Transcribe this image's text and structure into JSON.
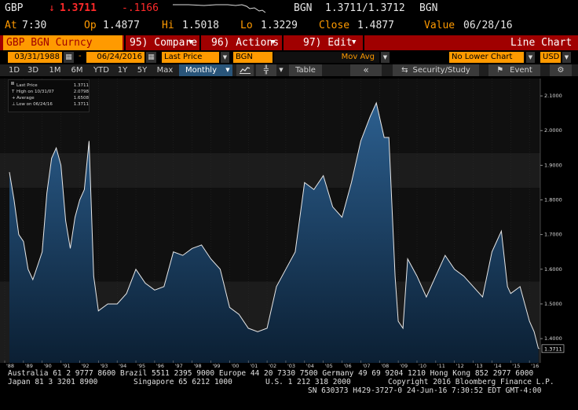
{
  "header": {
    "ticker": "GBP",
    "arrow": "↓",
    "last": "1.3711",
    "change": "-.1166",
    "source": "BGN",
    "bid_ask": "1.3711/1.3712",
    "source2": "BGN",
    "at_label": "At",
    "at_time": "7:30",
    "op_label": "Op",
    "op_value": "1.4877",
    "hi_label": "Hi",
    "hi_value": "1.5018",
    "lo_label": "Lo",
    "lo_value": "1.3229",
    "close_label": "Close",
    "close_value": "1.4877",
    "value_label": "Value",
    "value_date": "06/28/16"
  },
  "menubar": {
    "title": "GBP BGN Curncy",
    "compare": "95) Compare",
    "actions": "96) Actions",
    "edit": "97) Edit",
    "chart_type": "Line Chart"
  },
  "inputs": {
    "start_date": "03/31/1988",
    "dash": "-",
    "end_date": "06/24/2016",
    "field": "Last Price",
    "source": "BGN",
    "study": "Mov Avg",
    "lower_chart": "No Lower Chart",
    "currency": "USD"
  },
  "toolbar": {
    "periods": [
      "1D",
      "3D",
      "1M",
      "6M",
      "YTD",
      "1Y",
      "5Y",
      "Max"
    ],
    "frequency": "Monthly",
    "table": "Table",
    "security_study": "Security/Study",
    "event": "Event"
  },
  "legend": {
    "rows": [
      {
        "label": "Last Price",
        "value": "1.3711"
      },
      {
        "label": "High on 10/31/07",
        "value": "2.0798"
      },
      {
        "label": "Average",
        "value": "1.6508"
      },
      {
        "label": "Low on 06/24/16",
        "value": "1.3711"
      }
    ]
  },
  "chart_data": {
    "type": "area",
    "title": "",
    "xlabel": "",
    "ylabel": "",
    "ylim": [
      1.33,
      2.15
    ],
    "yticks": [
      "2.1000",
      "2.0000",
      "1.9000",
      "1.8000",
      "1.7000",
      "1.6000",
      "1.5000",
      "1.4000"
    ],
    "ytick_values": [
      2.1,
      2.0,
      1.9,
      1.8,
      1.7,
      1.6,
      1.5,
      1.4
    ],
    "xticks": [
      "'88",
      "'89",
      "'90",
      "'91",
      "'92",
      "'93",
      "'94",
      "'95",
      "'96",
      "'97",
      "'98",
      "'99",
      "'00",
      "'01",
      "'02",
      "'03",
      "'04",
      "'05",
      "'06",
      "'07",
      "'08",
      "'09",
      "'10",
      "'11",
      "'12",
      "'13",
      "'14",
      "'15",
      "'16"
    ],
    "last_value_label": "1.3711",
    "series": [
      {
        "x": [
          1988.25,
          1988.5,
          1988.75,
          1989.0,
          1989.25,
          1989.5,
          1989.75,
          1990.0,
          1990.25,
          1990.5,
          1990.75,
          1991.0,
          1991.25,
          1991.5,
          1991.75,
          1992.0,
          1992.25,
          1992.5,
          1992.75,
          1993.0,
          1993.5,
          1994.0,
          1994.5,
          1995.0,
          1995.5,
          1996.0,
          1996.5,
          1997.0,
          1997.5,
          1998.0,
          1998.5,
          1999.0,
          1999.5,
          2000.0,
          2000.5,
          2001.0,
          2001.5,
          2002.0,
          2002.5,
          2003.0,
          2003.5,
          2004.0,
          2004.5,
          2005.0,
          2005.5,
          2006.0,
          2006.5,
          2007.0,
          2007.5,
          2007.83,
          2008.25,
          2008.5,
          2008.83,
          2009.0,
          2009.25,
          2009.5,
          2010.0,
          2010.5,
          2011.0,
          2011.5,
          2012.0,
          2012.5,
          2013.0,
          2013.5,
          2014.0,
          2014.5,
          2014.83,
          2015.0,
          2015.5,
          2016.0,
          2016.25,
          2016.48
        ],
        "y": [
          1.88,
          1.8,
          1.7,
          1.68,
          1.6,
          1.57,
          1.61,
          1.65,
          1.82,
          1.92,
          1.95,
          1.9,
          1.74,
          1.66,
          1.75,
          1.8,
          1.83,
          1.97,
          1.58,
          1.48,
          1.5,
          1.5,
          1.53,
          1.6,
          1.56,
          1.54,
          1.55,
          1.65,
          1.64,
          1.66,
          1.67,
          1.63,
          1.6,
          1.49,
          1.47,
          1.43,
          1.42,
          1.43,
          1.55,
          1.6,
          1.65,
          1.85,
          1.83,
          1.87,
          1.78,
          1.75,
          1.85,
          1.97,
          2.04,
          2.0798,
          1.98,
          1.98,
          1.58,
          1.45,
          1.43,
          1.63,
          1.58,
          1.52,
          1.58,
          1.64,
          1.6,
          1.58,
          1.55,
          1.52,
          1.65,
          1.71,
          1.55,
          1.53,
          1.55,
          1.45,
          1.42,
          1.3711
        ]
      }
    ]
  },
  "footer": {
    "line1": "Australia 61 2 9777 8600 Brazil 5511 2395 9000 Europe 44 20 7330 7500 Germany 49 69 9204 1210 Hong Kong 852 2977 6000",
    "line2a": "Japan 81 3 3201 8900",
    "line2b": "Singapore 65 6212 1000",
    "line2c": "U.S. 1 212 318 2000",
    "line2d": "Copyright 2016 Bloomberg Finance L.P.",
    "line3": "SN 630373 H429-3727-0 24-Jun-16  7:30:52 EDT  GMT-4:00"
  }
}
